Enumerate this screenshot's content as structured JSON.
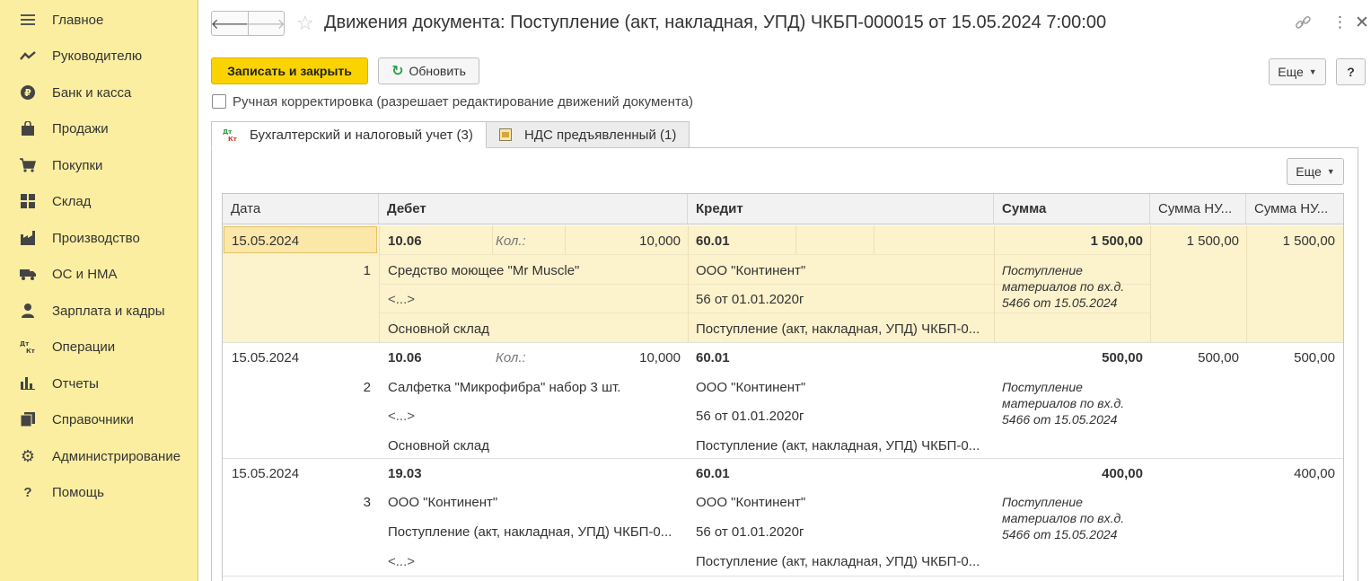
{
  "sidebar": {
    "items": [
      {
        "label": "Главное",
        "icon": "menu-icon"
      },
      {
        "label": "Руководителю",
        "icon": "trend-icon"
      },
      {
        "label": "Банк и касса",
        "icon": "ruble-icon"
      },
      {
        "label": "Продажи",
        "icon": "bag-icon"
      },
      {
        "label": "Покупки",
        "icon": "cart-icon"
      },
      {
        "label": "Склад",
        "icon": "warehouse-icon"
      },
      {
        "label": "Производство",
        "icon": "factory-icon"
      },
      {
        "label": "ОС и НМА",
        "icon": "truck-icon"
      },
      {
        "label": "Зарплата и кадры",
        "icon": "person-icon"
      },
      {
        "label": "Операции",
        "icon": "dt-kt-icon"
      },
      {
        "label": "Отчеты",
        "icon": "bar-chart-icon"
      },
      {
        "label": "Справочники",
        "icon": "books-icon"
      },
      {
        "label": "Администрирование",
        "icon": "gear-icon"
      },
      {
        "label": "Помощь",
        "icon": "question-icon"
      }
    ]
  },
  "header": {
    "title": "Движения документа: Поступление (акт, накладная, УПД) ЧКБП-000015 от 15.05.2024 7:00:00"
  },
  "toolbar": {
    "save_close": "Записать и закрыть",
    "refresh": "Обновить",
    "more": "Еще",
    "help": "?"
  },
  "manual_edit": {
    "label": "Ручная корректировка (разрешает редактирование движений документа)",
    "checked": false
  },
  "tabs": [
    {
      "label": "Бухгалтерский и налоговый учет (3)",
      "icon": "dt-kt-icon",
      "active": true
    },
    {
      "label": "НДС предъявленный (1)",
      "icon": "register-icon",
      "active": false
    }
  ],
  "table": {
    "more": "Еще",
    "columns": [
      "Дата",
      "Дебет",
      "Кредит",
      "Сумма",
      "Сумма НУ...",
      "Сумма НУ..."
    ],
    "rows": [
      {
        "date": "15.05.2024",
        "num": "1",
        "debit_account": "10.06",
        "qty_label": "Кол.:",
        "qty": "10,000",
        "debit_sub1": "Средство моющее \"Mr Muscle\"",
        "debit_sub2": "<...>",
        "debit_sub3": "Основной склад",
        "credit_account": "60.01",
        "credit_sub1": "ООО \"Континент\"",
        "credit_sub2": "56 от 01.01.2020г",
        "credit_sub3": "Поступление (акт, накладная, УПД) ЧКБП-0...",
        "sum": "1 500,00",
        "desc": "Поступление материалов по вх.д. 5466 от 15.05.2024",
        "sum_nu_dt": "1 500,00",
        "sum_nu_kt": "1 500,00"
      },
      {
        "date": "15.05.2024",
        "num": "2",
        "debit_account": "10.06",
        "qty_label": "Кол.:",
        "qty": "10,000",
        "debit_sub1": "Салфетка \"Микрофибра\" набор 3 шт.",
        "debit_sub2": "<...>",
        "debit_sub3": "Основной склад",
        "credit_account": "60.01",
        "credit_sub1": "ООО \"Континент\"",
        "credit_sub2": "56 от 01.01.2020г",
        "credit_sub3": "Поступление (акт, накладная, УПД) ЧКБП-0...",
        "sum": "500,00",
        "desc": "Поступление материалов по вх.д. 5466 от 15.05.2024",
        "sum_nu_dt": "500,00",
        "sum_nu_kt": "500,00"
      },
      {
        "date": "15.05.2024",
        "num": "3",
        "debit_account": "19.03",
        "qty_label": "",
        "qty": "",
        "debit_sub1": "ООО \"Континент\"",
        "debit_sub2": "Поступление (акт, накладная, УПД) ЧКБП-0...",
        "debit_sub3": "<...>",
        "credit_account": "60.01",
        "credit_sub1": "ООО \"Континент\"",
        "credit_sub2": "56 от 01.01.2020г",
        "credit_sub3": "Поступление (акт, накладная, УПД) ЧКБП-0...",
        "sum": "400,00",
        "desc": "Поступление материалов по вх.д. 5466 от 15.05.2024",
        "sum_nu_dt": "",
        "sum_nu_kt": "400,00"
      }
    ]
  }
}
